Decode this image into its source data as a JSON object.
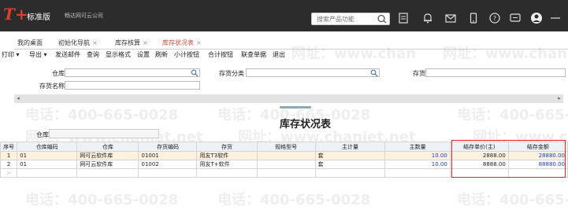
{
  "app": {
    "logo": "T+",
    "brand": "标准版",
    "company": "畅达网可云公司"
  },
  "search": {
    "placeholder": "搜索产品功能"
  },
  "topbar_icons": [
    "grid-icon",
    "bell-icon",
    "mail-icon",
    "phone-icon",
    "help-icon",
    "message-icon",
    "user-avatar-icon"
  ],
  "tabs": [
    {
      "label": "我的桌面",
      "closable": false
    },
    {
      "label": "初始化导航",
      "closable": true
    },
    {
      "label": "库存核算",
      "closable": true
    },
    {
      "label": "库存状况表",
      "closable": true,
      "active": true
    }
  ],
  "toolbar": {
    "print": "打印",
    "export": "导出",
    "send_email": "发送邮件",
    "query": "查询",
    "show_format": "显示格式",
    "settings": "设置",
    "refresh": "刷新",
    "subtotal": "小计按钮",
    "total": "合计按钮",
    "linked_query": "联查单据",
    "exit": "退出"
  },
  "filter": {
    "warehouse_label": "仓库",
    "category_label": "存货分类",
    "inventory_label": "存货",
    "inventory_name_label": "存货名称"
  },
  "watermarks": {
    "phone": "电话：400-665-0028",
    "phone_short": "电话：400-665-",
    "site": "网址：www.chanjet.net",
    "site_short": "网址：www.chan"
  },
  "report": {
    "title": "库存状况表",
    "warehouse_label": "仓库"
  },
  "table": {
    "headers": [
      "序号",
      "仓库编码",
      "仓库",
      "存货编码",
      "存货",
      "规格型号",
      "主计量",
      "主数量",
      "结存单价(主)",
      "结存金额"
    ],
    "rows": [
      [
        "1",
        "01",
        "网可云软件库",
        "01001",
        "用友T3软件",
        "",
        "套",
        "10.00",
        "2888.00",
        "28880.00"
      ],
      [
        "2",
        "01",
        "网可云软件库",
        "01002",
        "用友T+软件",
        "",
        "套",
        "10.00",
        "8888.00",
        "88880.00"
      ]
    ]
  },
  "colors": {
    "topbar_bg": "#2c2c2c",
    "logo_red": "#e23b2e",
    "active_tab": "#d14a3a",
    "highlight_box": "#d6282a",
    "number_blue": "#1a3fb3",
    "row_highlight": "#fff1e0"
  }
}
